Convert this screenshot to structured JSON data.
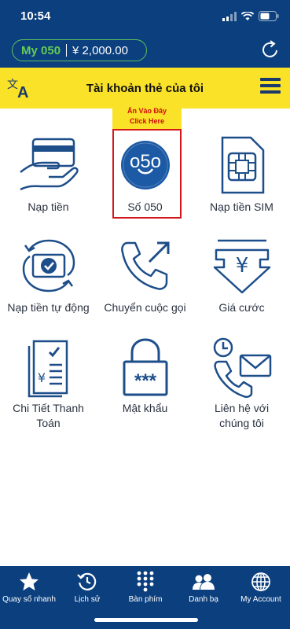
{
  "status": {
    "time": "10:54"
  },
  "header": {
    "plan_label": "My 050",
    "balance": "¥ 2,000.00"
  },
  "titlebar": {
    "title": "Tài khoản thẻ của tôi"
  },
  "hint": {
    "line1": "Ấn Vào Đây",
    "line2": "Click Here"
  },
  "grid": {
    "items": [
      {
        "label": "Nạp tiền",
        "icon": "card-hand-icon"
      },
      {
        "label": "Số 050",
        "icon": "050-logo-icon"
      },
      {
        "label": "Nạp tiền SIM",
        "icon": "sim-card-icon"
      },
      {
        "label": "Nạp tiền tự động",
        "icon": "auto-recharge-icon"
      },
      {
        "label": "Chuyển cuộc gọi",
        "icon": "call-forward-icon"
      },
      {
        "label": "Giá cước",
        "icon": "yen-price-icon"
      },
      {
        "label": "Chi Tiết Thanh Toán",
        "icon": "invoice-icon"
      },
      {
        "label": "Mật khẩu",
        "icon": "password-lock-icon"
      },
      {
        "label": "Liên hệ với chúng tôi",
        "icon": "contact-icon"
      }
    ]
  },
  "tabbar": {
    "items": [
      {
        "label": "Quay số nhanh",
        "icon": "star-icon"
      },
      {
        "label": "Lịch sử",
        "icon": "history-icon"
      },
      {
        "label": "Bàn phím",
        "icon": "keypad-icon"
      },
      {
        "label": "Danh bạ",
        "icon": "contacts-icon"
      },
      {
        "label": "My Account",
        "icon": "globe-icon"
      }
    ]
  },
  "colors": {
    "primary": "#0b3f7e",
    "accent_yellow": "#f9e227",
    "accent_green": "#66cc55",
    "highlight_red": "#d3171b"
  }
}
